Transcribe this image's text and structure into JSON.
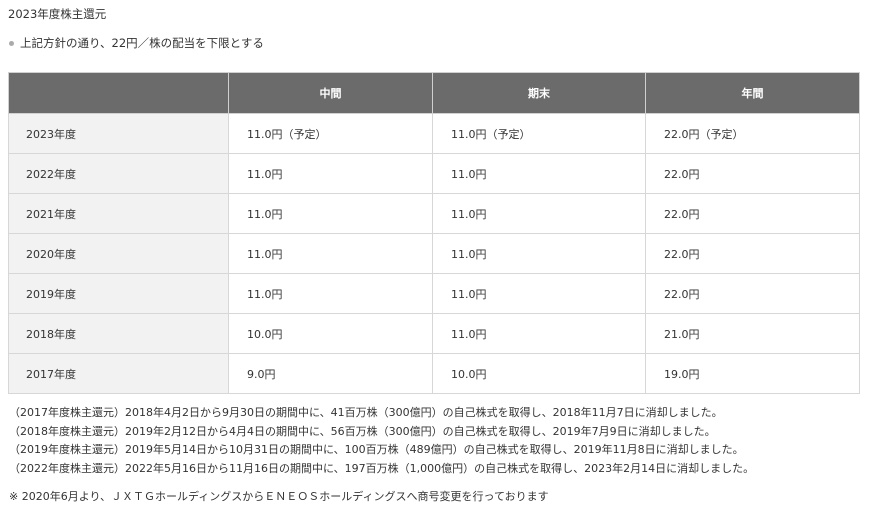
{
  "title": "2023年度株主還元",
  "policy_note": "上記方針の通り、22円／株の配当を下限とする",
  "table": {
    "headers": [
      "",
      "中間",
      "期末",
      "年間"
    ],
    "rows": [
      [
        "2023年度",
        "11.0円（予定）",
        "11.0円（予定）",
        "22.0円（予定）"
      ],
      [
        "2022年度",
        "11.0円",
        "11.0円",
        "22.0円"
      ],
      [
        "2021年度",
        "11.0円",
        "11.0円",
        "22.0円"
      ],
      [
        "2020年度",
        "11.0円",
        "11.0円",
        "22.0円"
      ],
      [
        "2019年度",
        "11.0円",
        "11.0円",
        "22.0円"
      ],
      [
        "2018年度",
        "10.0円",
        "11.0円",
        "21.0円"
      ],
      [
        "2017年度",
        "9.0円",
        "10.0円",
        "19.0円"
      ]
    ]
  },
  "notes": [
    "（2017年度株主還元）2018年4月2日から9月30日の期間中に、41百万株（300億円）の自己株式を取得し、2018年11月7日に消却しました。",
    "（2018年度株主還元）2019年2月12日から4月4日の期間中に、56百万株（300億円）の自己株式を取得し、2019年7月9日に消却しました。",
    "（2019年度株主還元）2019年5月14日から10月31日の期間中に、100百万株（489億円）の自己株式を取得し、2019年11月8日に消却しました。",
    "（2022年度株主還元）2022年5月16日から11月16日の期間中に、197百万株（1,000億円）の自己株式を取得し、2023年2月14日に消却しました。"
  ],
  "footnote": "※ 2020年6月より、ＪＸＴＧホールディングスからＥＮＥＯＳホールディングスへ商号変更を行っております"
}
